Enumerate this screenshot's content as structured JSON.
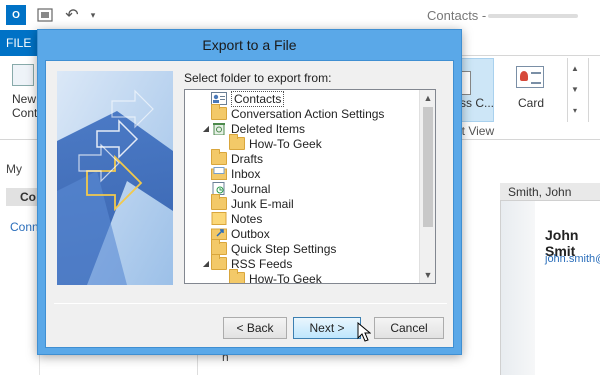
{
  "app": {
    "logo_text": "O",
    "window_title": "Contacts -"
  },
  "ribbon": {
    "file_tab": "FILE",
    "new_contact_label_1": "New",
    "new_contact_label_2": "Conta",
    "business_card_label": "ss C...",
    "card_label": "Card",
    "current_view_label": "nt View"
  },
  "left_pane": {
    "my_label": "My",
    "contacts_selected": "Co",
    "connect_link": "Conn"
  },
  "contact_panel": {
    "header": "Smith, John",
    "name": "John Smit",
    "email": "john.smith@"
  },
  "background": {
    "letter": "h"
  },
  "dialog": {
    "title": "Export to a File",
    "prompt": "Select folder to export from:",
    "folders": [
      {
        "label": "Contacts",
        "level": 1,
        "expander": "",
        "icon": "contacts-icon",
        "selected": true
      },
      {
        "label": "Conversation Action Settings",
        "level": 1,
        "expander": "",
        "icon": "folder-icon"
      },
      {
        "label": "Deleted Items",
        "level": 1,
        "expander": "◢",
        "icon": "deleted-items-icon"
      },
      {
        "label": "How-To Geek",
        "level": 2,
        "expander": "",
        "icon": "folder-icon"
      },
      {
        "label": "Drafts",
        "level": 1,
        "expander": "",
        "icon": "folder-icon"
      },
      {
        "label": "Inbox",
        "level": 1,
        "expander": "",
        "icon": "inbox-icon"
      },
      {
        "label": "Journal",
        "level": 1,
        "expander": "",
        "icon": "journal-icon"
      },
      {
        "label": "Junk E-mail",
        "level": 1,
        "expander": "",
        "icon": "folder-icon"
      },
      {
        "label": "Notes",
        "level": 1,
        "expander": "",
        "icon": "notes-icon"
      },
      {
        "label": "Outbox",
        "level": 1,
        "expander": "",
        "icon": "outbox-icon"
      },
      {
        "label": "Quick Step Settings",
        "level": 1,
        "expander": "",
        "icon": "folder-icon"
      },
      {
        "label": "RSS Feeds",
        "level": 1,
        "expander": "◢",
        "icon": "folder-icon"
      },
      {
        "label": "How-To Geek",
        "level": 2,
        "expander": "",
        "icon": "folder-icon"
      }
    ],
    "buttons": {
      "back": "< Back",
      "next": "Next >",
      "cancel": "Cancel"
    }
  }
}
